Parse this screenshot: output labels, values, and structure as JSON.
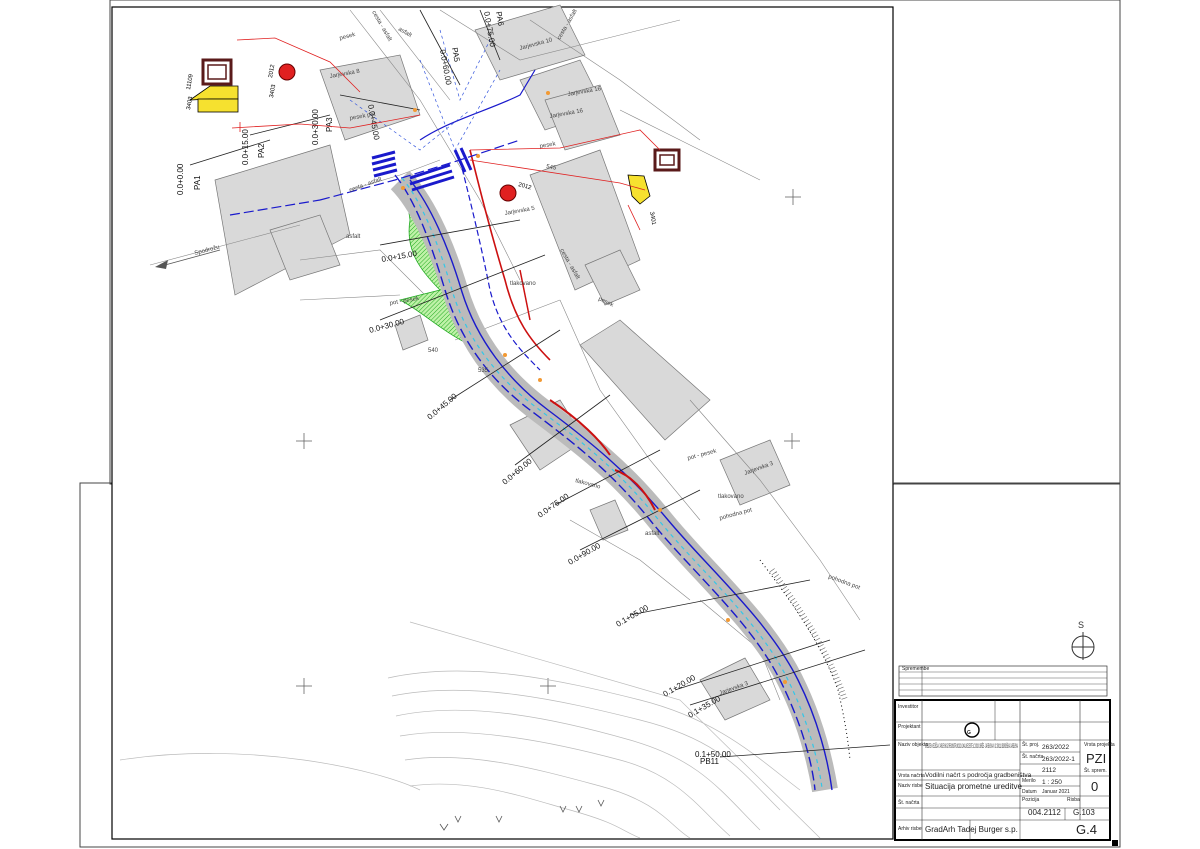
{
  "station_labels": [
    {
      "id": "PA1",
      "text": "PA1"
    },
    {
      "id": "PA1_ch",
      "text": "0.0+0.00"
    },
    {
      "id": "PA2",
      "text": "PA2"
    },
    {
      "id": "PA2_ch",
      "text": "0.0+15.00"
    },
    {
      "id": "PA3",
      "text": "PA3"
    },
    {
      "id": "PA3_ch",
      "text": "0.0+30.00"
    },
    {
      "id": "PA4_ch",
      "text": "0.0+45.00"
    },
    {
      "id": "PA5",
      "text": "PA5"
    },
    {
      "id": "PA5_ch",
      "text": "0.0+60.00"
    },
    {
      "id": "PA6",
      "text": "PA6"
    },
    {
      "id": "PA6_ch",
      "text": "0.0+75.00"
    },
    {
      "id": "PB2_ch",
      "text": "0.0+15.00"
    },
    {
      "id": "PB3_ch",
      "text": "0.0+30.00"
    },
    {
      "id": "PB4_ch",
      "text": "0.0+45.00"
    },
    {
      "id": "PB5_ch",
      "text": "0.0+60.00"
    },
    {
      "id": "PB6_ch",
      "text": "0.0+75.00"
    },
    {
      "id": "PB7_ch",
      "text": "0.0+90.00"
    },
    {
      "id": "PB8_ch",
      "text": "0.1+05.00"
    },
    {
      "id": "PB9_ch",
      "text": "0.1+20.00"
    },
    {
      "id": "PB10_ch",
      "text": "0.1+35.00"
    },
    {
      "id": "PB11",
      "text": "PB11"
    },
    {
      "id": "PB11_ch",
      "text": "0.1+50.00"
    }
  ],
  "map_labels": {
    "pesek": "pesek",
    "pesek_pot": "pesek pot",
    "asfalt": "asfalt",
    "ceste_asfalt": "cesta - asfalt",
    "tlakovano": "tlakovano",
    "pot_pesek": "pot - pesek",
    "pohodna_pot": "pohodna pot",
    "jarjevska8": "Jarjevska 8",
    "jarjevska10": "Jarjevska 10",
    "jarjevska16": "Jarjevska 16",
    "jarjevska5": "Jarjevska 5",
    "jarjevska3": "Jarjevska 3",
    "spodaj": "Spodrožu",
    "contour540": "540",
    "contour535": "535",
    "contour545": "545"
  },
  "signs": {
    "sign1": "3403",
    "sign2": "2012",
    "sign3": "3403",
    "sign4": "11109",
    "sign5": "3401",
    "sign6": "2012"
  },
  "title_block": {
    "row_investitor": "Investitor",
    "row_projektant": "Projektant",
    "row_naziv_objekta": "Naziv objekta",
    "row_vrsta_nacrta": "Vrsta načrta",
    "row_naziv_risbe": "Naziv risbe",
    "row_st_nacrta": "Št. načrta",
    "row_arhiv": "Arhiv risbe",
    "naziv_objekta_text": "UREDITEV VEZIŠČA V JARJEVSKI IZ REKONSTRUKCIJO LOKALNE CESTE LC 300101 BRIŽE - JARJEVSKA V UC 300111 OBOROŠEVA JARJEVSKA",
    "vrsta_nacrta": "Vodilni načrt s področja gradbeništva",
    "naziv_risbe": "Situacija prometne ureditve",
    "st_projekta_label": "Št. proj.",
    "st_projekta": "263/2022",
    "st_nacrta_label": "Št. načrta",
    "st_nacrta": "263/2022-1",
    "st_dela": "2112",
    "vrsta_projekta_label": "Vrsta projekta",
    "vrsta_projekta": "PZI",
    "merilo_label": "Merilo",
    "merilo": "1 : 250",
    "datum_label": "Datum",
    "datum": "Januar 2021",
    "sprememba_label": "Št. sprem.",
    "sprememba": "0",
    "dwg_label": "Pozicija",
    "dwg": "004.2112",
    "risba_label": "Risba",
    "risba": "G.103",
    "folder": "G.4",
    "firm": "GradArh Tadej Burger s.p.",
    "revisions_header": "Spremembe"
  },
  "north_arrow": {
    "label": "S"
  }
}
